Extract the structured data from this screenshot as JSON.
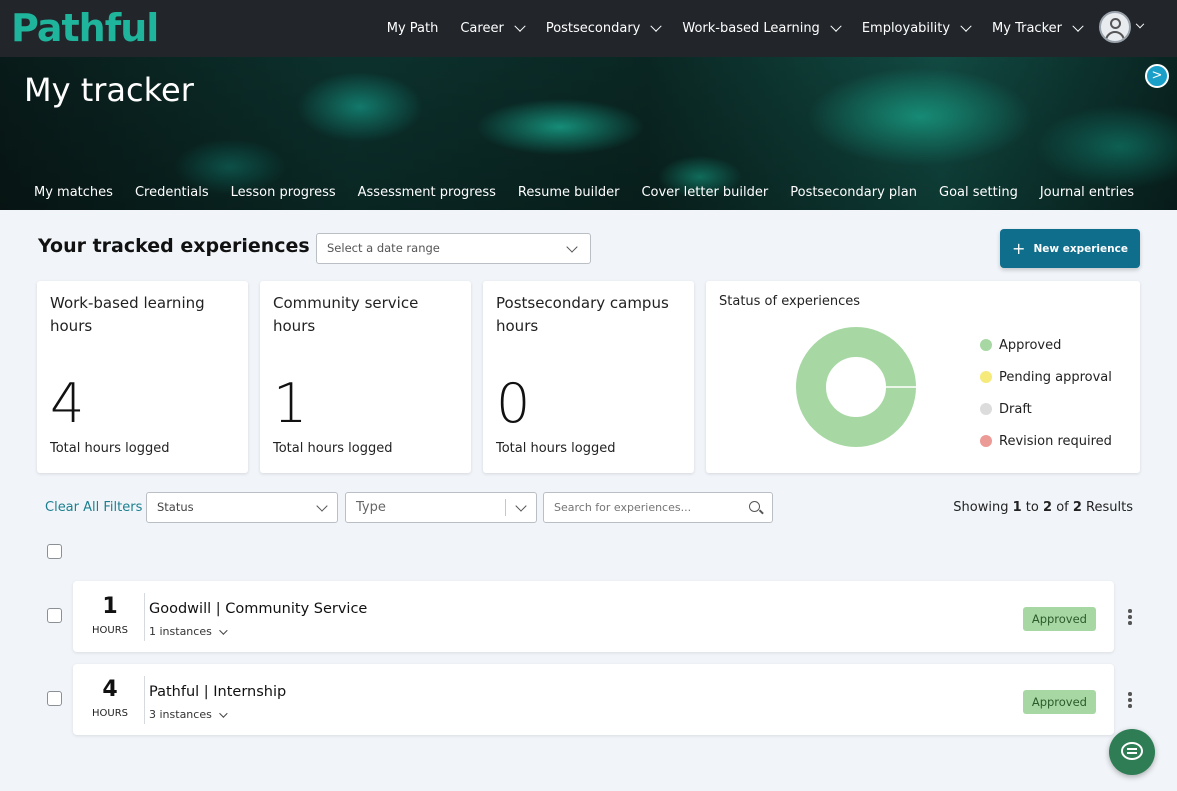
{
  "brand": {
    "name": "Pathful",
    "logo_color": "#1fb59c"
  },
  "nav": {
    "items": [
      {
        "label": "My Path",
        "has_dropdown": false
      },
      {
        "label": "Career",
        "has_dropdown": true
      },
      {
        "label": "Postsecondary",
        "has_dropdown": true
      },
      {
        "label": "Work-based Learning",
        "has_dropdown": true
      },
      {
        "label": "Employability",
        "has_dropdown": true
      },
      {
        "label": "My Tracker",
        "has_dropdown": true
      }
    ],
    "avatar_icon": "user-circle-icon"
  },
  "hero": {
    "title": "My tracker"
  },
  "subnav": {
    "items": [
      "My matches",
      "Credentials",
      "Lesson progress",
      "Assessment progress",
      "Resume builder",
      "Cover letter builder",
      "Postsecondary plan",
      "Goal setting",
      "Journal entries"
    ],
    "next_icon": "chevron-right-icon"
  },
  "section": {
    "title": "Your tracked experiences",
    "date_range_placeholder": "Select a date range",
    "new_button_label": "New experience"
  },
  "stats": [
    {
      "label": "Work-based learning hours",
      "value": "4",
      "sub": "Total hours logged"
    },
    {
      "label": "Community service hours",
      "value": "1",
      "sub": "Total hours logged"
    },
    {
      "label": "Postsecondary campus hours",
      "value": "0",
      "sub": "Total hours logged"
    }
  ],
  "status_chart": {
    "title": "Status of experiences",
    "legend": [
      {
        "label": "Approved",
        "color": "#a7d8a3"
      },
      {
        "label": "Pending approval",
        "color": "#f5ea7a"
      },
      {
        "label": "Draft",
        "color": "#dcdcdc"
      },
      {
        "label": "Revision required",
        "color": "#eb9a96"
      }
    ]
  },
  "chart_data": {
    "type": "pie",
    "title": "Status of experiences",
    "categories": [
      "Approved",
      "Pending approval",
      "Draft",
      "Revision required"
    ],
    "values": [
      2,
      0,
      0,
      0
    ],
    "colors": [
      "#a7d8a3",
      "#f5ea7a",
      "#dcdcdc",
      "#eb9a96"
    ],
    "donut": true,
    "legend": "right"
  },
  "filters": {
    "clear_label": "Clear All Filters",
    "status_placeholder": "Status",
    "type_placeholder": "Type",
    "search_placeholder": "Search for experiences...",
    "results": {
      "prefix": "Showing",
      "from": "1",
      "to_word": "to",
      "to": "2",
      "of_word": "of",
      "total": "2",
      "suffix": "Results"
    }
  },
  "experiences": [
    {
      "hours": "1",
      "unit": "HOURS",
      "title": "Goodwill | Community Service",
      "instances": "1 instances",
      "status": "Approved"
    },
    {
      "hours": "4",
      "unit": "HOURS",
      "title": "Pathful | Internship",
      "instances": "3 instances",
      "status": "Approved"
    }
  ],
  "chat": {
    "icon": "chat-bubble-icon"
  }
}
